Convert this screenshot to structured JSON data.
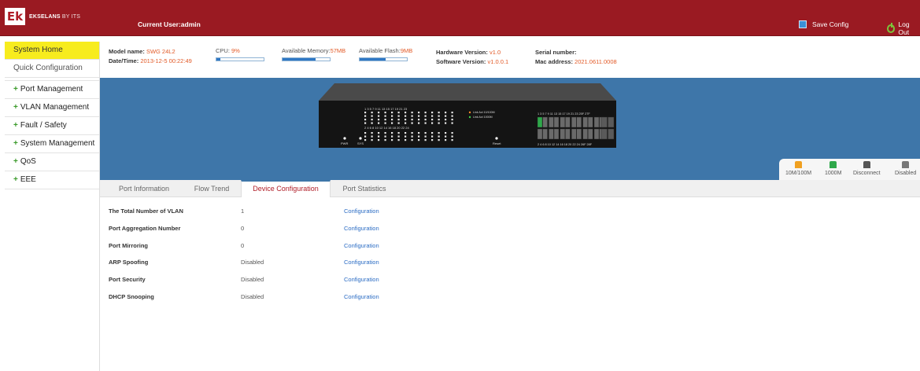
{
  "header": {
    "logo_mark": "Ek",
    "logo_brand": "EKSELANS",
    "logo_suffix": "BY ITS",
    "current_user": "Current User:admin",
    "save_config": "Save Config",
    "log_out": "Log Out"
  },
  "sidebar": {
    "items": [
      {
        "label": "System Home",
        "active": true,
        "plus": ""
      },
      {
        "label": "Quick Configuration",
        "active": false,
        "plus": ""
      },
      {
        "label": "Port Management",
        "active": false,
        "plus": "+"
      },
      {
        "label": "VLAN Management",
        "active": false,
        "plus": "+"
      },
      {
        "label": "Fault / Safety",
        "active": false,
        "plus": "+"
      },
      {
        "label": "System Management",
        "active": false,
        "plus": "+"
      },
      {
        "label": "QoS",
        "active": false,
        "plus": "+"
      },
      {
        "label": "EEE",
        "active": false,
        "plus": "+"
      }
    ]
  },
  "info": {
    "model_label": "Model name:",
    "model_value": "SWG 24L2",
    "datetime_label": "Date/Time:",
    "datetime_value": "2013-12-5 00:22:49",
    "cpu_label": "CPU:",
    "cpu_value": "9%",
    "cpu_fraction": 0.09,
    "memory_label": "Available Memory:",
    "memory_value": "57MB",
    "memory_fraction": 0.7,
    "flash_label": "Available Flash:",
    "flash_value": "9MB",
    "flash_fraction": 0.55,
    "hw_label": "Hardware Version:",
    "hw_value": "v1.0",
    "sw_label": "Software Version:",
    "sw_value": "v1.0.0.1",
    "serial_label": "Serial number:",
    "serial_value": "",
    "mac_label": "Mac address:",
    "mac_value": "2021.0611.0008"
  },
  "switch": {
    "led_top": "1 3 5 7 9 11 13 15 17 19 21 23",
    "led_bottom": "2 4 6 8 10 12 14 16 18 20 22 24",
    "pwr": "PWR",
    "sys": "SYS",
    "link_act_10_100": "Link Act 10/100M",
    "link_act_1000": "Link Act 1000M",
    "reset": "Reset",
    "ports_top": "1 3 5 7 9 11 13 15 17 19 21 23 25F 27F",
    "ports_bottom": "2 4 6 8 10 12 14 16 18 20 22 24 26F 28F"
  },
  "legend": [
    {
      "label": "10M/100M",
      "color": "#f0a020"
    },
    {
      "label": "1000M",
      "color": "#2ea84a"
    },
    {
      "label": "Disconnect",
      "color": "#555555"
    },
    {
      "label": "Disabled",
      "color": "#777777"
    }
  ],
  "tabs": [
    {
      "label": "Port Information",
      "active": false
    },
    {
      "label": "Flow Trend",
      "active": false
    },
    {
      "label": "Device Configuration",
      "active": true
    },
    {
      "label": "Port Statistics",
      "active": false
    }
  ],
  "device_config": {
    "rows": [
      {
        "label": "The Total Number of VLAN",
        "value": "1",
        "link": "Configuration"
      },
      {
        "label": "Port Aggregation Number",
        "value": "0",
        "link": "Configuration"
      },
      {
        "label": "Port Mirroring",
        "value": "0",
        "link": "Configuration"
      },
      {
        "label": "ARP Spoofing",
        "value": "Disabled",
        "link": "Configuration"
      },
      {
        "label": "Port Security",
        "value": "Disabled",
        "link": "Configuration"
      },
      {
        "label": "DHCP Snooping",
        "value": "Disabled",
        "link": "Configuration"
      }
    ]
  }
}
